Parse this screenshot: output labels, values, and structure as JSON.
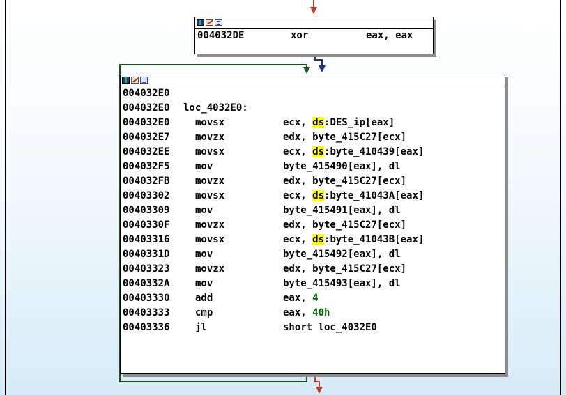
{
  "colors": {
    "background_top": "#ffffff",
    "background_bottom": "#d6ebf7",
    "node_border": "#000000",
    "node_shadow": "#8c8c8c",
    "highlight": "#ffff00",
    "immediate_text": "#006400",
    "edge_unconditional": "#000080",
    "edge_loop_back": "#1f4d1f",
    "edge_false": "#c0392b"
  },
  "header_icons": [
    "graph-overview-icon",
    "edit-pen-icon",
    "listing-icon"
  ],
  "node_top": {
    "lines": [
      {
        "addr": "004032DE",
        "mnemonic": "xor",
        "operands": [
          {
            "text": "eax, eax"
          }
        ]
      }
    ]
  },
  "node_main": {
    "lines": [
      {
        "addr": "004032E0",
        "mnemonic": "",
        "operands": []
      },
      {
        "addr": "004032E0",
        "label": "loc_4032E0:",
        "mnemonic": "",
        "operands": []
      },
      {
        "addr": "004032E0",
        "mnemonic": "movsx",
        "operands": [
          {
            "text": "ecx, "
          },
          {
            "text": "ds",
            "hl": true
          },
          {
            "text": ":DES_ip[eax]"
          }
        ]
      },
      {
        "addr": "004032E7",
        "mnemonic": "movzx",
        "operands": [
          {
            "text": "edx, byte_415C27[ecx]"
          }
        ]
      },
      {
        "addr": "004032EE",
        "mnemonic": "movsx",
        "operands": [
          {
            "text": "ecx, "
          },
          {
            "text": "ds",
            "hl": true
          },
          {
            "text": ":byte_410439[eax]"
          }
        ]
      },
      {
        "addr": "004032F5",
        "mnemonic": "mov",
        "operands": [
          {
            "text": "byte_415490[eax], dl"
          }
        ]
      },
      {
        "addr": "004032FB",
        "mnemonic": "movzx",
        "operands": [
          {
            "text": "edx, byte_415C27[ecx]"
          }
        ]
      },
      {
        "addr": "00403302",
        "mnemonic": "movsx",
        "operands": [
          {
            "text": "ecx, "
          },
          {
            "text": "ds",
            "hl": true
          },
          {
            "text": ":byte_41043A[eax]"
          }
        ]
      },
      {
        "addr": "00403309",
        "mnemonic": "mov",
        "operands": [
          {
            "text": "byte_415491[eax], dl"
          }
        ]
      },
      {
        "addr": "0040330F",
        "mnemonic": "movzx",
        "operands": [
          {
            "text": "edx, byte_415C27[ecx]"
          }
        ]
      },
      {
        "addr": "00403316",
        "mnemonic": "movsx",
        "operands": [
          {
            "text": "ecx, "
          },
          {
            "text": "ds",
            "hl": true
          },
          {
            "text": ":byte_41043B[eax]"
          }
        ]
      },
      {
        "addr": "0040331D",
        "mnemonic": "mov",
        "operands": [
          {
            "text": "byte_415492[eax], dl"
          }
        ]
      },
      {
        "addr": "00403323",
        "mnemonic": "movzx",
        "operands": [
          {
            "text": "edx, byte_415C27[ecx]"
          }
        ]
      },
      {
        "addr": "0040332A",
        "mnemonic": "mov",
        "operands": [
          {
            "text": "byte_415493[eax], dl"
          }
        ]
      },
      {
        "addr": "00403330",
        "mnemonic": "add",
        "operands": [
          {
            "text": "eax, "
          },
          {
            "text": "4",
            "num": true
          }
        ]
      },
      {
        "addr": "00403333",
        "mnemonic": "cmp",
        "operands": [
          {
            "text": "eax, "
          },
          {
            "text": "40h",
            "num": true
          }
        ]
      },
      {
        "addr": "00403336",
        "mnemonic": "jl",
        "operands": [
          {
            "text": "short loc_4032E0"
          }
        ]
      }
    ]
  }
}
